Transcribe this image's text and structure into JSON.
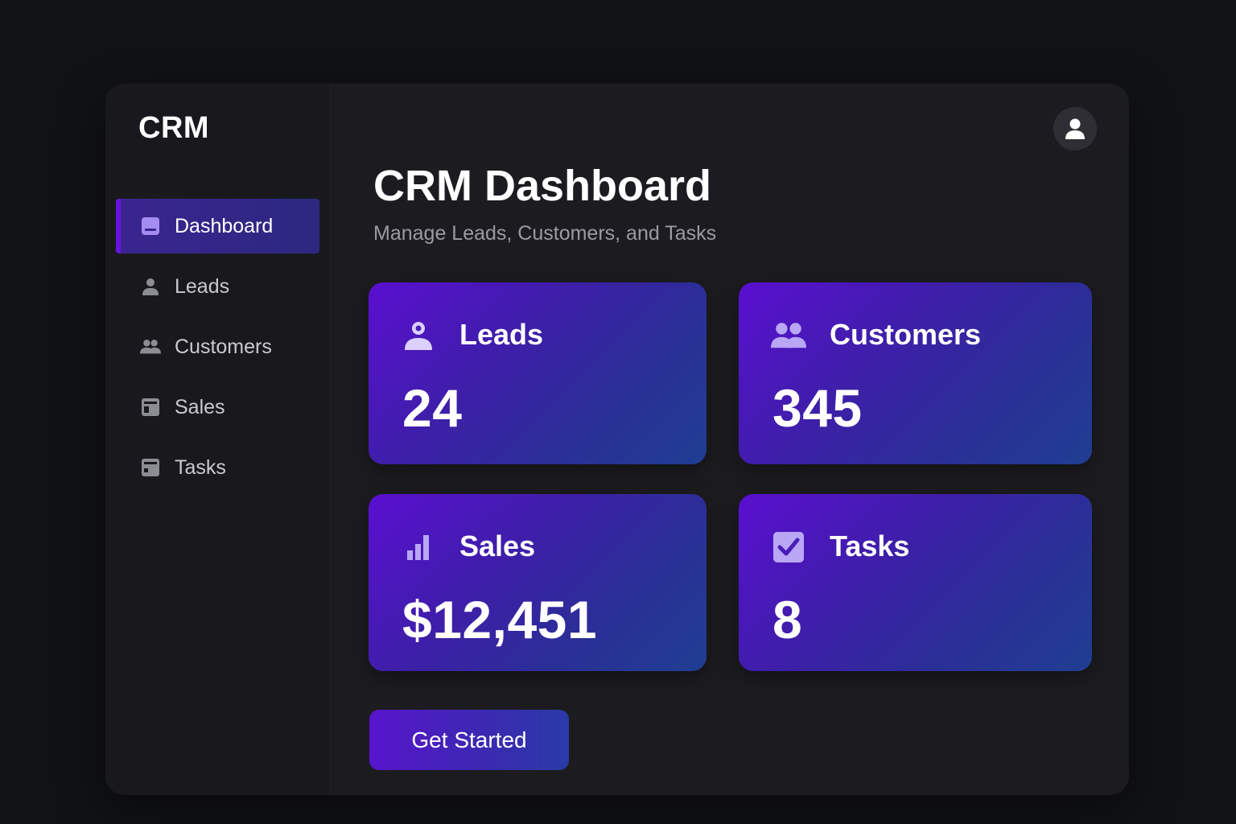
{
  "sidebar": {
    "brand": "CRM",
    "items": [
      {
        "label": "Dashboard",
        "icon": "dashboard-icon",
        "active": true
      },
      {
        "label": "Leads",
        "icon": "person-icon",
        "active": false
      },
      {
        "label": "Customers",
        "icon": "people-icon",
        "active": false
      },
      {
        "label": "Sales",
        "icon": "sales-icon",
        "active": false
      },
      {
        "label": "Tasks",
        "icon": "tasks-icon",
        "active": false
      }
    ]
  },
  "header": {
    "avatar_icon": "user-avatar-icon"
  },
  "main": {
    "title": "CRM Dashboard",
    "subtitle": "Manage Leads, Customers, and Tasks",
    "cards": [
      {
        "label": "Leads",
        "value": "24",
        "icon": "person-icon"
      },
      {
        "label": "Customers",
        "value": "345",
        "icon": "people-icon"
      },
      {
        "label": "Sales",
        "value": "$12,451",
        "icon": "bar-chart-icon"
      },
      {
        "label": "Tasks",
        "value": "8",
        "icon": "checkbox-icon"
      }
    ],
    "cta_label": "Get Started"
  },
  "colors": {
    "background": "#111216",
    "panel": "#1c1c20",
    "accent": "#6a12e0",
    "card_gradient_start": "#5a0fd0",
    "card_gradient_end": "#1f3e92",
    "muted_text": "#9a9aa3"
  }
}
